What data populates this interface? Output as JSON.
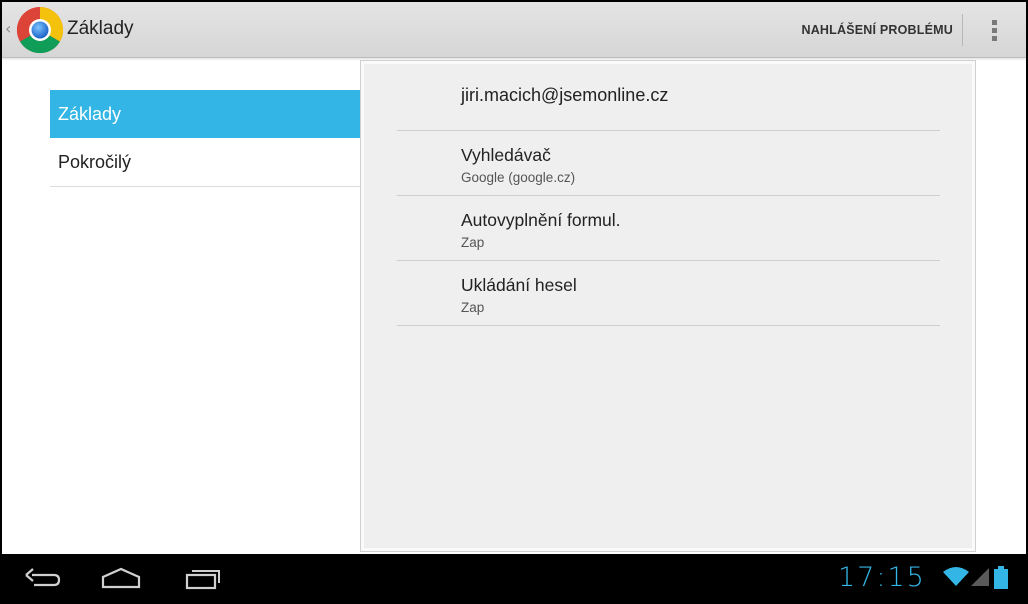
{
  "action_bar": {
    "title": "Základy",
    "report_button": "NAHLÁŠENÍ PROBLÉMU",
    "app_icon": "chrome-logo-icon",
    "overflow_icon": "overflow-menu-icon"
  },
  "headers": [
    {
      "label": "Základy",
      "selected": true
    },
    {
      "label": "Pokročilý",
      "selected": false
    }
  ],
  "account": "jiri.macich@jsemonline.cz",
  "preferences": [
    {
      "title": "Vyhledávač",
      "summary": "Google (google.cz)"
    },
    {
      "title": "Autovyplnění formul.",
      "summary": "Zap"
    },
    {
      "title": "Ukládání hesel",
      "summary": "Zap"
    }
  ],
  "system_bar": {
    "time": "17:15",
    "icons": [
      "back-icon",
      "home-icon",
      "recent-apps-icon",
      "wifi-icon",
      "cell-signal-icon",
      "battery-icon"
    ]
  },
  "colors": {
    "accent": "#33b5e5",
    "action_bar": "#dcdcdc",
    "panel": "#efefef"
  }
}
